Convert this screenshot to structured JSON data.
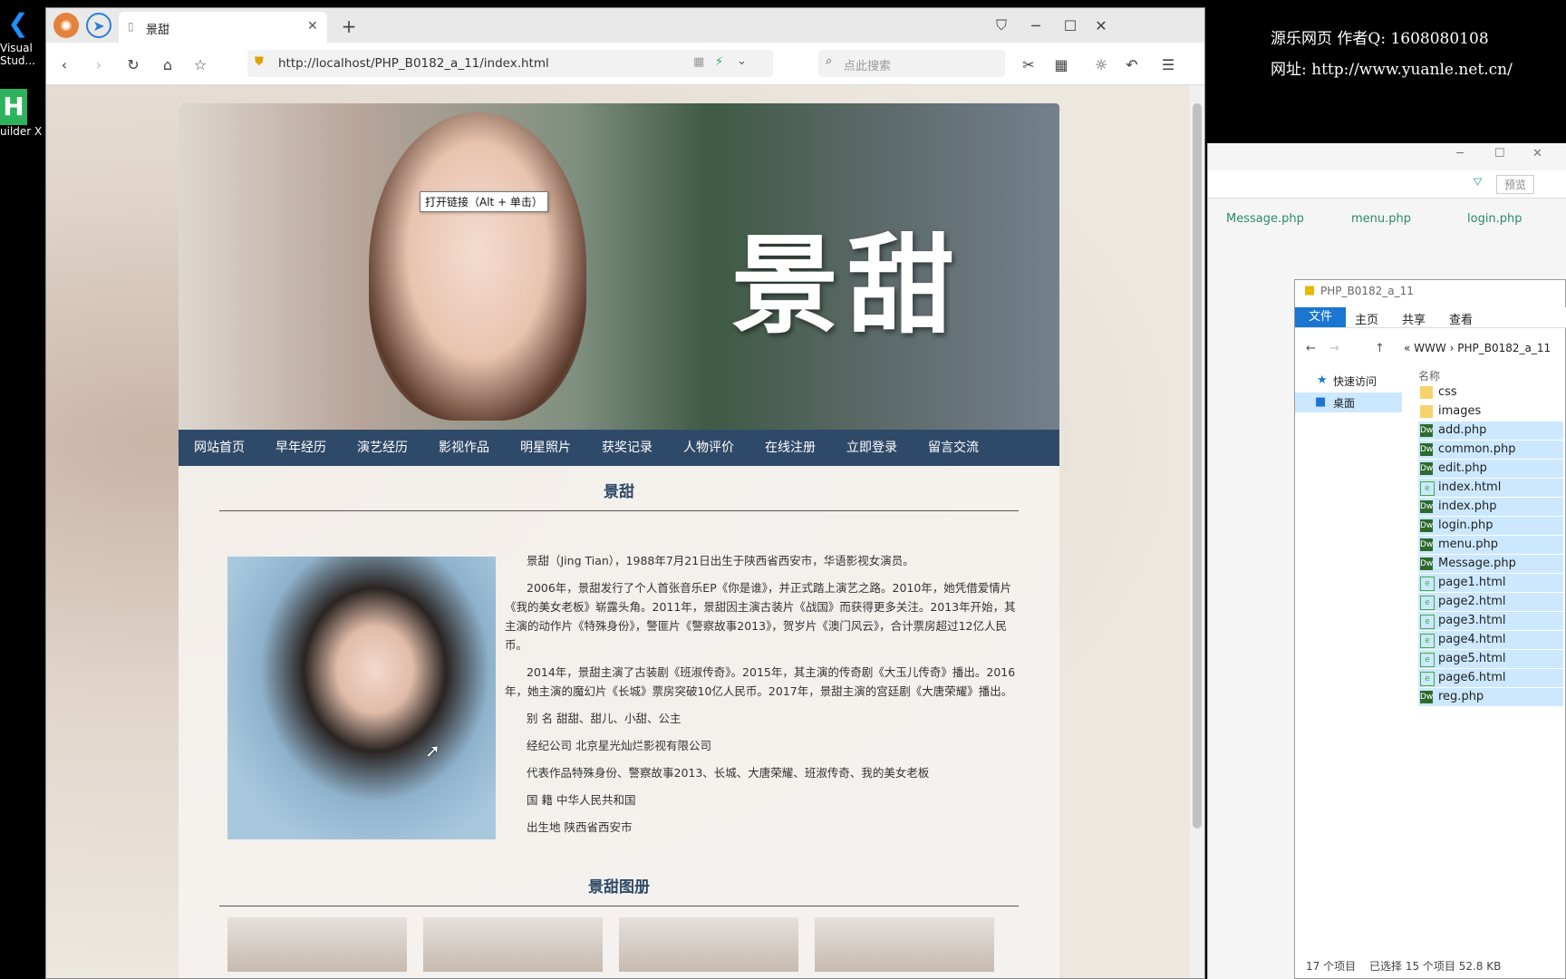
{
  "desktop": {
    "icons": [
      {
        "label": "Visual\nStud...",
        "glyph": "vscode-icon"
      },
      {
        "label": "uilder X",
        "glyph": "hbuilder-icon"
      }
    ]
  },
  "browser": {
    "tab_title": "景甜",
    "url": "http://localhost/PHP_B0182_a_11/index.html",
    "search_placeholder": "点此搜索",
    "tooltip": "打开链接（Alt + 单击）"
  },
  "site": {
    "banner_title": "景甜",
    "nav": [
      "网站首页",
      "早年经历",
      "演艺经历",
      "影视作品",
      "明星照片",
      "获奖记录",
      "人物评价",
      "在线注册",
      "立即登录",
      "留言交流"
    ],
    "section1_title": "景甜",
    "bio": [
      "景甜（Jing Tian），1988年7月21日出生于陕西省西安市，华语影视女演员。",
      "2006年，景甜发行了个人首张音乐EP《你是谁》，并正式踏上演艺之路。2010年，她凭借爱情片《我的美女老板》崭露头角。2011年，景甜因主演古装片《战国》而获得更多关注。2013年开始，其主演的动作片《特殊身份》，警匪片《警察故事2013》，贺岁片《澳门风云》，合计票房超过12亿人民币。",
      "2014年，景甜主演了古装剧《班淑传奇》。2015年，其主演的传奇剧《大玉儿传奇》播出。2016年，她主演的魔幻片《长城》票房突破10亿人民币。2017年，景甜主演的宫廷剧《大唐荣耀》播出。",
      "别 名 甜甜、甜儿、小甜、公主",
      "经纪公司 北京星光灿烂影视有限公司",
      "代表作品特殊身份、警察故事2013、长城、大唐荣耀、班淑传奇、我的美女老板",
      "国 籍 中华人民共和国",
      "出生地 陕西省西安市"
    ],
    "section2_title": "景甜图册"
  },
  "watermark": {
    "line1": "源乐网页  作者Q: 1608080108",
    "line2": "网址: http://www.yuanle.net.cn/"
  },
  "editor": {
    "tabs": [
      "Message.php",
      "menu.php",
      "login.php"
    ],
    "preview_label": "预览"
  },
  "explorer": {
    "title": "PHP_B0182_a_11",
    "ribbon": [
      "文件",
      "主页",
      "共享",
      "查看"
    ],
    "path": [
      "«",
      "WWW",
      "›",
      "PHP_B0182_a_11"
    ],
    "nav_items": [
      "快速访问",
      "桌面"
    ],
    "column_header": "名称",
    "files": [
      {
        "name": "css",
        "type": "folder",
        "selected": false
      },
      {
        "name": "images",
        "type": "folder",
        "selected": false
      },
      {
        "name": "add.php",
        "type": "php",
        "selected": true
      },
      {
        "name": "common.php",
        "type": "php",
        "selected": true
      },
      {
        "name": "edit.php",
        "type": "php",
        "selected": true
      },
      {
        "name": "index.html",
        "type": "html",
        "selected": true
      },
      {
        "name": "index.php",
        "type": "php",
        "selected": true
      },
      {
        "name": "login.php",
        "type": "php",
        "selected": true
      },
      {
        "name": "menu.php",
        "type": "php",
        "selected": true
      },
      {
        "name": "Message.php",
        "type": "php",
        "selected": true
      },
      {
        "name": "page1.html",
        "type": "html",
        "selected": true
      },
      {
        "name": "page2.html",
        "type": "html",
        "selected": true
      },
      {
        "name": "page3.html",
        "type": "html",
        "selected": true
      },
      {
        "name": "page4.html",
        "type": "html",
        "selected": true
      },
      {
        "name": "page5.html",
        "type": "html",
        "selected": true
      },
      {
        "name": "page6.html",
        "type": "html",
        "selected": true
      },
      {
        "name": "reg.php",
        "type": "php",
        "selected": true
      }
    ],
    "status_count": "17 个项目",
    "status_selected": "已选择 15 个项目  52.8 KB"
  },
  "colors": {
    "nav_bg": "#2f4a68",
    "accent": "#0078d7",
    "php_icon": "#2d6a2d"
  }
}
